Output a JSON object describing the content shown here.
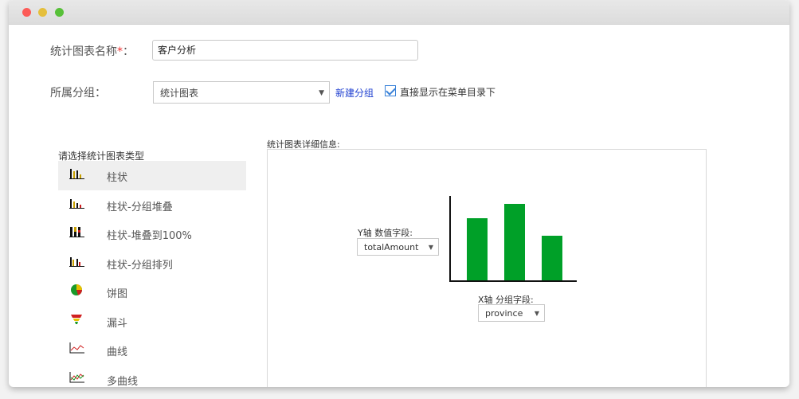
{
  "form": {
    "name_label": "统计图表名称",
    "required_mark": "*",
    "name_colon": "：",
    "name_value": "客户分析",
    "group_label": "所属分组：",
    "group_value": "统计图表",
    "new_group_link": "新建分组",
    "show_in_menu_label": "直接显示在菜单目录下",
    "show_in_menu_checked": true
  },
  "chart_types": {
    "title": "请选择统计图表类型",
    "items": [
      {
        "label": "柱状",
        "icon": "bar-chart-icon",
        "selected": true
      },
      {
        "label": "柱状-分组堆叠",
        "icon": "stacked-bar-icon",
        "selected": false
      },
      {
        "label": "柱状-堆叠到100%",
        "icon": "percent-stacked-bar-icon",
        "selected": false
      },
      {
        "label": "柱状-分组排列",
        "icon": "grouped-bar-icon",
        "selected": false
      },
      {
        "label": "饼图",
        "icon": "pie-chart-icon",
        "selected": false
      },
      {
        "label": "漏斗",
        "icon": "funnel-chart-icon",
        "selected": false
      },
      {
        "label": "曲线",
        "icon": "line-chart-icon",
        "selected": false
      },
      {
        "label": "多曲线",
        "icon": "multi-line-chart-icon",
        "selected": false
      }
    ]
  },
  "detail": {
    "title": "统计图表详细信息:",
    "y_axis_label": "Y轴 数值字段:",
    "y_axis_field": "totalAmount",
    "x_axis_label": "X轴 分组字段:",
    "x_axis_field": "province",
    "bar_color": "#00a028"
  },
  "chart_data": {
    "type": "bar",
    "values": [
      78,
      96,
      56
    ],
    "ylim": [
      0,
      100
    ]
  }
}
